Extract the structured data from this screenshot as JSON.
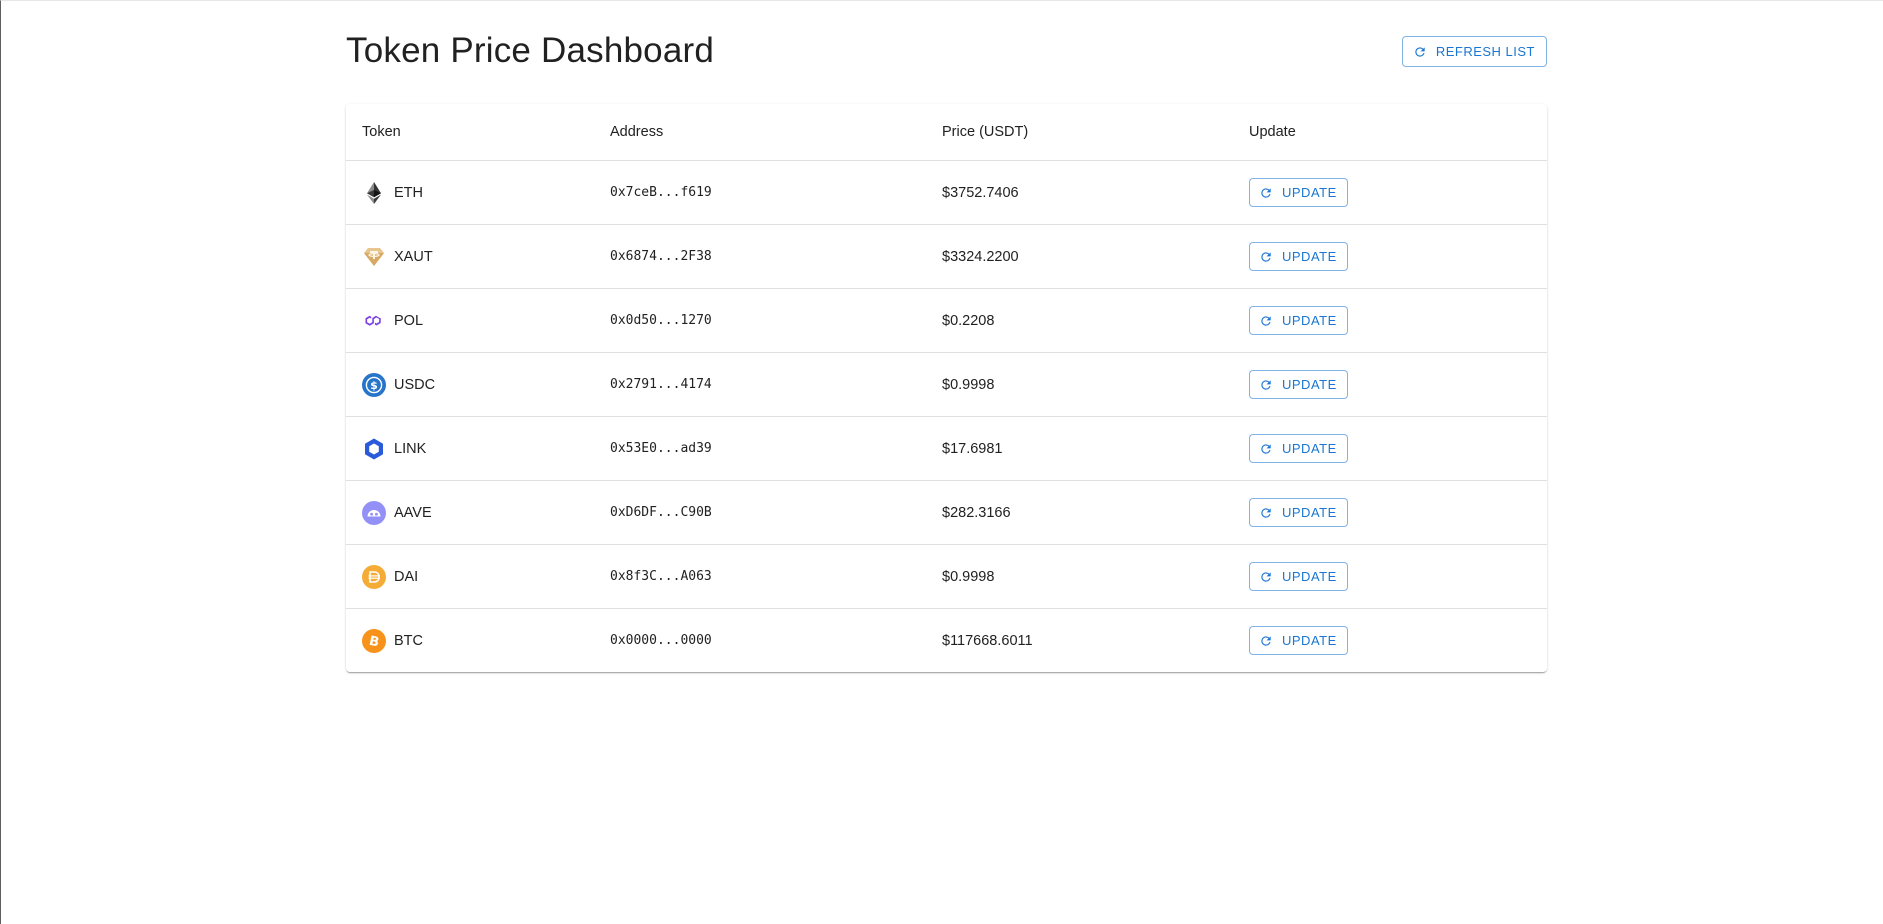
{
  "page": {
    "title": "Token Price Dashboard",
    "refresh_label": "REFRESH LIST"
  },
  "table": {
    "headers": [
      "Token",
      "Address",
      "Price (USDT)",
      "Update"
    ],
    "update_label": "UPDATE",
    "rows": [
      {
        "symbol": "ETH",
        "address": "0x7ceB...f619",
        "price": "$3752.7406",
        "icon": "ethereum-icon"
      },
      {
        "symbol": "XAUT",
        "address": "0x6874...2F38",
        "price": "$3324.2200",
        "icon": "tether-gold-icon"
      },
      {
        "symbol": "POL",
        "address": "0x0d50...1270",
        "price": "$0.2208",
        "icon": "polygon-icon"
      },
      {
        "symbol": "USDC",
        "address": "0x2791...4174",
        "price": "$0.9998",
        "icon": "usdc-icon"
      },
      {
        "symbol": "LINK",
        "address": "0x53E0...ad39",
        "price": "$17.6981",
        "icon": "chainlink-icon"
      },
      {
        "symbol": "AAVE",
        "address": "0xD6DF...C90B",
        "price": "$282.3166",
        "icon": "aave-icon"
      },
      {
        "symbol": "DAI",
        "address": "0x8f3C...A063",
        "price": "$0.9998",
        "icon": "dai-icon"
      },
      {
        "symbol": "BTC",
        "address": "0x0000...0000",
        "price": "$117668.6011",
        "icon": "bitcoin-icon"
      }
    ]
  },
  "colors": {
    "accent": "#1976d2",
    "text": "#212121",
    "divider": "#e0e0e0"
  }
}
